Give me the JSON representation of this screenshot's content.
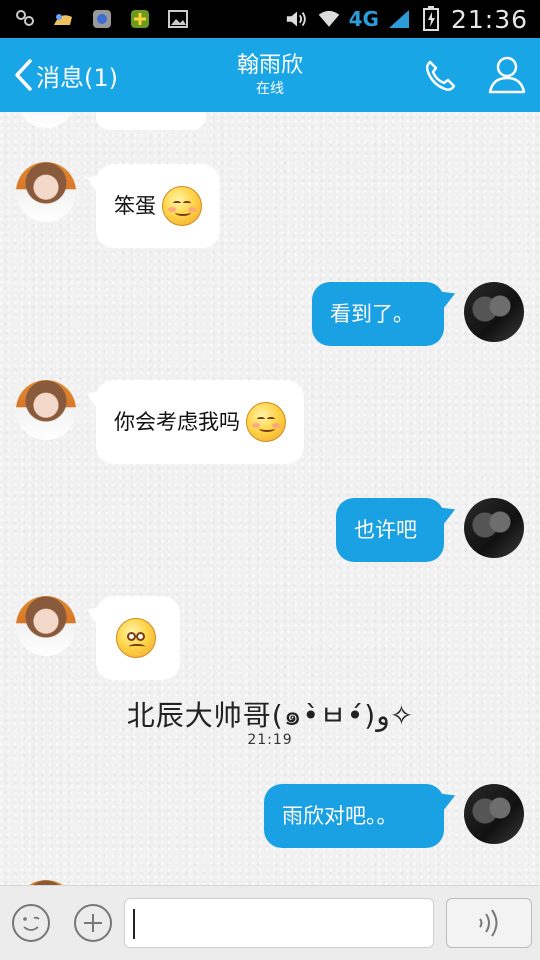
{
  "status_bar": {
    "network": "4G",
    "time": "21:36",
    "icons": [
      "app-icon-1",
      "app-icon-2",
      "app-icon-3",
      "app-icon-4",
      "gallery-icon",
      "volume-icon",
      "wifi-icon",
      "signal-icon",
      "battery-icon"
    ]
  },
  "header": {
    "back_label": "消息(1)",
    "contact_name": "翰雨欣",
    "contact_status": "在线",
    "icons": [
      "back-chevron-icon",
      "phone-icon",
      "profile-icon"
    ]
  },
  "messages": [
    {
      "id": "m1",
      "side": "in",
      "text": "笨蛋",
      "emoji": "smile-emoji"
    },
    {
      "id": "m2",
      "side": "out",
      "text": "看到了。"
    },
    {
      "id": "m3",
      "side": "in",
      "text": "你会考虑我吗",
      "emoji": "smile-emoji"
    },
    {
      "id": "m4",
      "side": "out",
      "text": "也许吧"
    },
    {
      "id": "m5",
      "side": "in",
      "text": "",
      "emoji": "worried-emoji"
    },
    {
      "id": "m6",
      "side": "out",
      "text": "雨欣对吧。。"
    }
  ],
  "system": {
    "nickname_line": "北辰大帅哥(๑•̀ㅂ•́)و✧",
    "timestamp": "21:19"
  },
  "input_bar": {
    "text_value": "",
    "icons": [
      "emoji-face-icon",
      "plus-icon",
      "voice-icon"
    ]
  },
  "colors": {
    "accent": "#19a6e6",
    "outgoing_bubble": "#1aa1e3",
    "incoming_bubble": "#ffffff"
  }
}
